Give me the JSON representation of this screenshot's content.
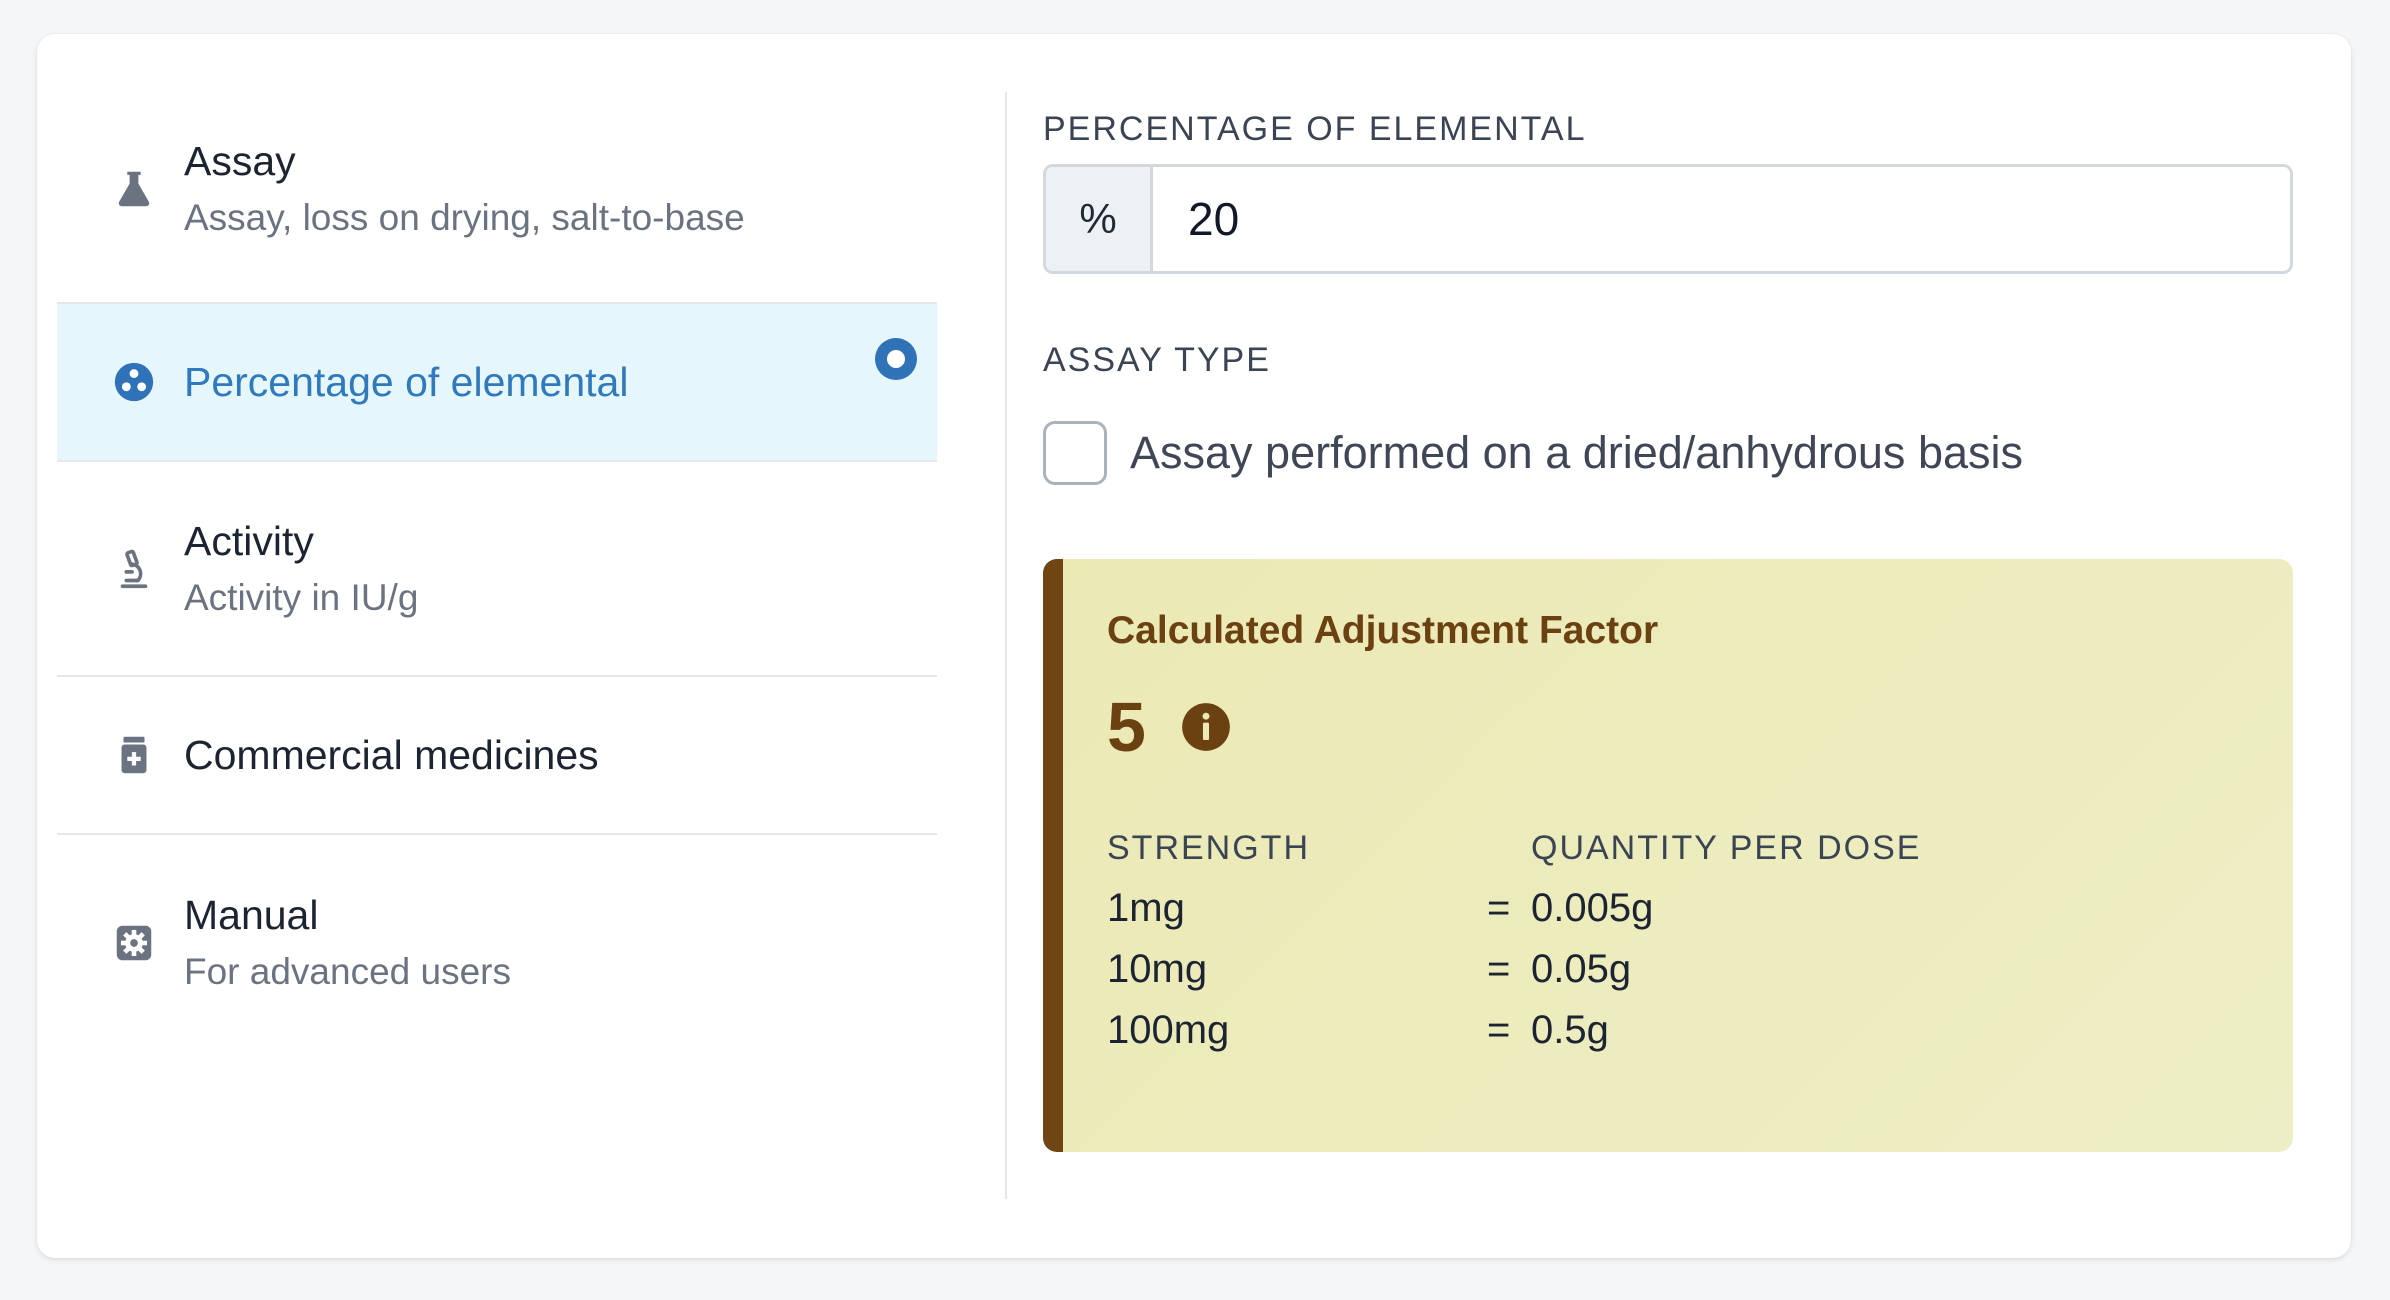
{
  "menu": {
    "items": [
      {
        "title": "Assay",
        "subtitle": "Assay, loss on drying, salt-to-base",
        "icon": "flask-icon"
      },
      {
        "title": "Percentage of elemental",
        "subtitle": "",
        "icon": "elements-icon",
        "selected": true
      },
      {
        "title": "Activity",
        "subtitle": "Activity in IU/g",
        "icon": "microscope-icon"
      },
      {
        "title": "Commercial medicines",
        "subtitle": "",
        "icon": "medicine-bottle-icon"
      },
      {
        "title": "Manual",
        "subtitle": "For advanced users",
        "icon": "gear-icon"
      }
    ]
  },
  "form": {
    "percentage_label": "PERCENTAGE OF ELEMENTAL",
    "percentage_addon": "%",
    "percentage_value": "20",
    "assay_type_label": "ASSAY TYPE",
    "checkbox_label": "Assay performed on a dried/anhydrous basis",
    "checkbox_checked": false
  },
  "result": {
    "title": "Calculated Adjustment Factor",
    "factor": "5",
    "strength_header": "STRENGTH",
    "quantity_header": "QUANTITY PER DOSE",
    "rows": [
      {
        "strength": "1mg",
        "eq": "=",
        "quantity": "0.005g"
      },
      {
        "strength": "10mg",
        "eq": "=",
        "quantity": "0.05g"
      },
      {
        "strength": "100mg",
        "eq": "=",
        "quantity": "0.5g"
      }
    ],
    "accent_color": "#6f4514"
  },
  "colors": {
    "selected_bg": "#e6f6fd",
    "selected_text": "#2f79bc",
    "result_bg": "#ebe9b4"
  }
}
